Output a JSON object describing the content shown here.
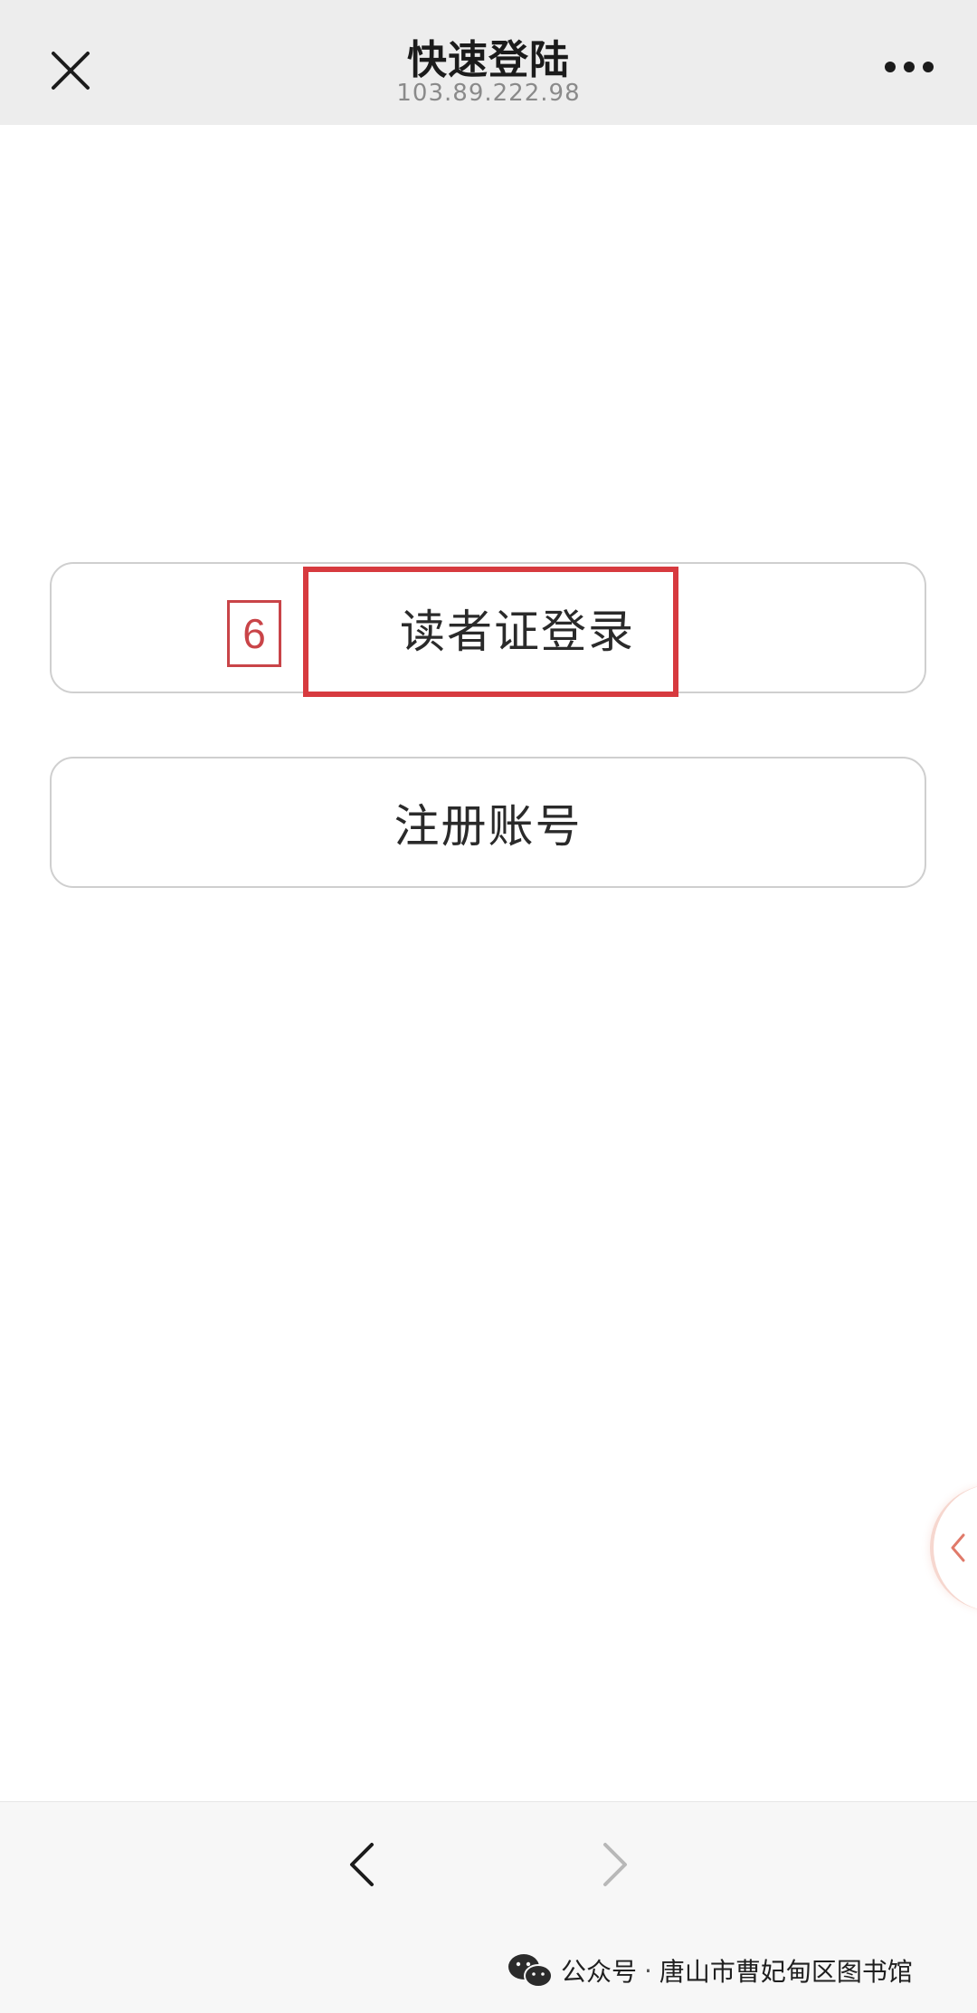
{
  "header": {
    "title": "快速登陆",
    "subtitle": "103.89.222.98",
    "close_icon": "close-icon",
    "more_icon": "more-dots-icon"
  },
  "main": {
    "login_button": "读者证登录",
    "register_button": "注册账号",
    "step_badge": "6",
    "highlight_color": "#d73a3f"
  },
  "bottom_nav": {
    "back_icon": "chevron-left-icon",
    "forward_icon": "chevron-right-icon"
  },
  "watermark": {
    "prefix": "公众号",
    "separator": "·",
    "name": "唐山市曹妃甸区图书馆",
    "icon": "wechat-icon"
  }
}
